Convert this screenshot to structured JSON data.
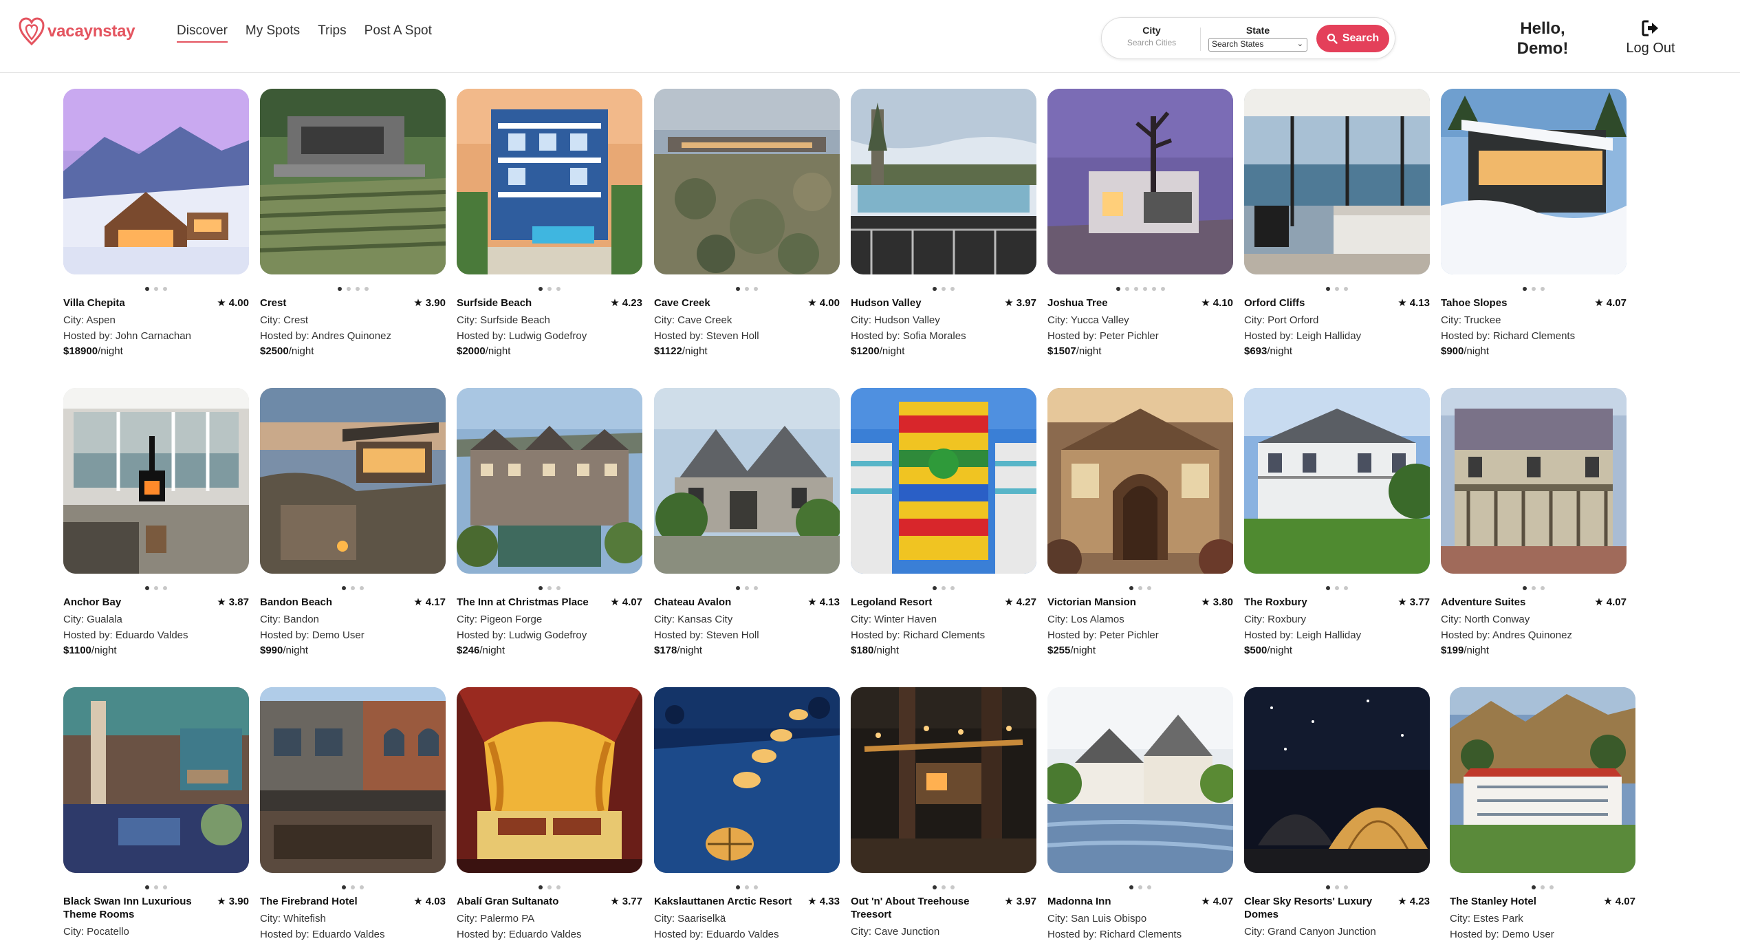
{
  "brand": {
    "name": "vacaynstay",
    "color": "#e4545f"
  },
  "nav": {
    "items": [
      {
        "label": "Discover",
        "active": true
      },
      {
        "label": "My Spots",
        "active": false
      },
      {
        "label": "Trips",
        "active": false
      },
      {
        "label": "Post A Spot",
        "active": false
      }
    ]
  },
  "search": {
    "city_label": "City",
    "city_placeholder": "Search Cities",
    "city_value": "",
    "state_label": "State",
    "state_selected": "Search States",
    "button_label": "Search",
    "button_color": "#e4405a"
  },
  "user": {
    "greeting": "Hello, Demo!",
    "logout_label": "Log Out"
  },
  "listings": [
    {
      "name": "Villa Chepita",
      "rating": "★ 4.00",
      "city": "City: Aspen",
      "host": "Hosted by: John Carnachan",
      "price": "$18900",
      "per": "/night",
      "image_count": 3,
      "active_image": 0,
      "scene": "mountain-chalet"
    },
    {
      "name": "Crest",
      "rating": "★ 3.90",
      "city": "City: Crest",
      "host": "Hosted by: Andres Quinonez",
      "price": "$2500",
      "per": "/night",
      "image_count": 4,
      "active_image": 0,
      "scene": "terraced-modern"
    },
    {
      "name": "Surfside Beach",
      "rating": "★ 4.23",
      "city": "City: Surfside Beach",
      "host": "Hosted by: Ludwig Godefroy",
      "price": "$2000",
      "per": "/night",
      "image_count": 3,
      "active_image": 0,
      "scene": "blue-beach-house"
    },
    {
      "name": "Cave Creek",
      "rating": "★ 4.00",
      "city": "City: Cave Creek",
      "host": "Hosted by: Steven Holl",
      "price": "$1122",
      "per": "/night",
      "image_count": 3,
      "active_image": 0,
      "scene": "desert-modern"
    },
    {
      "name": "Hudson Valley",
      "rating": "★ 3.97",
      "city": "City: Hudson Valley",
      "host": "Hosted by: Sofia Morales",
      "price": "$1200",
      "per": "/night",
      "image_count": 3,
      "active_image": 0,
      "scene": "pool-deck"
    },
    {
      "name": "Joshua Tree",
      "rating": "★ 4.10",
      "city": "City: Yucca Valley",
      "host": "Hosted by: Peter Pichler",
      "price": "$1507",
      "per": "/night",
      "image_count": 6,
      "active_image": 0,
      "scene": "joshua-dusk"
    },
    {
      "name": "Orford Cliffs",
      "rating": "★ 4.13",
      "city": "City: Port Orford",
      "host": "Hosted by: Leigh Halliday",
      "price": "$693",
      "per": "/night",
      "image_count": 3,
      "active_image": 0,
      "scene": "ocean-bedroom"
    },
    {
      "name": "Tahoe Slopes",
      "rating": "★ 4.07",
      "city": "City: Truckee",
      "host": "Hosted by: Richard Clements",
      "price": "$900",
      "per": "/night",
      "image_count": 3,
      "active_image": 0,
      "scene": "snow-modern"
    },
    {
      "name": "Anchor Bay",
      "rating": "★ 3.87",
      "city": "City: Gualala",
      "host": "Hosted by: Eduardo Valdes",
      "price": "$1100",
      "per": "/night",
      "image_count": 3,
      "active_image": 0,
      "scene": "fireplace-room"
    },
    {
      "name": "Bandon Beach",
      "rating": "★ 4.17",
      "city": "City: Bandon",
      "host": "Hosted by: Demo User",
      "price": "$990",
      "per": "/night",
      "image_count": 3,
      "active_image": 0,
      "scene": "cliff-cabin"
    },
    {
      "name": "The Inn at Christmas Place",
      "rating": "★ 4.07",
      "city": "City: Pigeon Forge",
      "host": "Hosted by: Ludwig Godefroy",
      "price": "$246",
      "per": "/night",
      "image_count": 3,
      "active_image": 0,
      "scene": "tudor-inn"
    },
    {
      "name": "Chateau Avalon",
      "rating": "★ 4.13",
      "city": "City: Kansas City",
      "host": "Hosted by: Steven Holl",
      "price": "$178",
      "per": "/night",
      "image_count": 3,
      "active_image": 0,
      "scene": "stone-chateau"
    },
    {
      "name": "Legoland Resort",
      "rating": "★ 4.27",
      "city": "City: Winter Haven",
      "host": "Hosted by: Richard Clements",
      "price": "$180",
      "per": "/night",
      "image_count": 3,
      "active_image": 0,
      "scene": "lego-tower"
    },
    {
      "name": "Victorian Mansion",
      "rating": "★ 3.80",
      "city": "City: Los Alamos",
      "host": "Hosted by: Peter Pichler",
      "price": "$255",
      "per": "/night",
      "image_count": 3,
      "active_image": 0,
      "scene": "victorian-porch"
    },
    {
      "name": "The Roxbury",
      "rating": "★ 3.77",
      "city": "City: Roxbury",
      "host": "Hosted by: Leigh Halliday",
      "price": "$500",
      "per": "/night",
      "image_count": 3,
      "active_image": 0,
      "scene": "white-colonial"
    },
    {
      "name": "Adventure Suites",
      "rating": "★ 4.07",
      "city": "City: North Conway",
      "host": "Hosted by: Andres Quinonez",
      "price": "$199",
      "per": "/night",
      "image_count": 3,
      "active_image": 0,
      "scene": "second-empire"
    },
    {
      "name": "Black Swan Inn Luxurious Theme Rooms",
      "rating": "★ 3.90",
      "city": "City: Pocatello",
      "host": "",
      "price": "",
      "per": "",
      "image_count": 3,
      "active_image": 0,
      "scene": "theme-room"
    },
    {
      "name": "The Firebrand Hotel",
      "rating": "★ 4.03",
      "city": "City: Whitefish",
      "host": "Hosted by: Eduardo Valdes",
      "price": "",
      "per": "",
      "image_count": 3,
      "active_image": 0,
      "scene": "brick-hotel"
    },
    {
      "name": "Abalí Gran Sultanato",
      "rating": "★ 3.77",
      "city": "City: Palermo PA",
      "host": "Hosted by: Eduardo Valdes",
      "price": "",
      "per": "",
      "image_count": 3,
      "active_image": 0,
      "scene": "sultan-bed"
    },
    {
      "name": "Kakslauttanen Arctic Resort",
      "rating": "★ 4.33",
      "city": "City: Saariselkä",
      "host": "Hosted by: Eduardo Valdes",
      "price": "",
      "per": "",
      "image_count": 3,
      "active_image": 0,
      "scene": "glass-igloos"
    },
    {
      "name": "Out 'n' About Treehouse Treesort",
      "rating": "★ 3.97",
      "city": "City: Cave Junction",
      "host": "",
      "price": "",
      "per": "",
      "image_count": 3,
      "active_image": 0,
      "scene": "treehouse-night"
    },
    {
      "name": "Madonna Inn",
      "rating": "★ 4.07",
      "city": "City: San Luis Obispo",
      "host": "Hosted by: Richard Clements",
      "price": "",
      "per": "",
      "image_count": 3,
      "active_image": 0,
      "scene": "inn-pond"
    },
    {
      "name": "Clear Sky Resorts' Luxury Domes",
      "rating": "★ 4.23",
      "city": "City: Grand Canyon Junction",
      "host": "",
      "price": "",
      "per": "",
      "image_count": 3,
      "active_image": 0,
      "scene": "dome-night"
    },
    {
      "name": "The Stanley Hotel",
      "rating": "★ 4.07",
      "city": "City: Estes Park",
      "host": "Hosted by: Demo User",
      "price": "",
      "per": "",
      "image_count": 3,
      "active_image": 0,
      "scene": "stanley-hotel"
    }
  ]
}
